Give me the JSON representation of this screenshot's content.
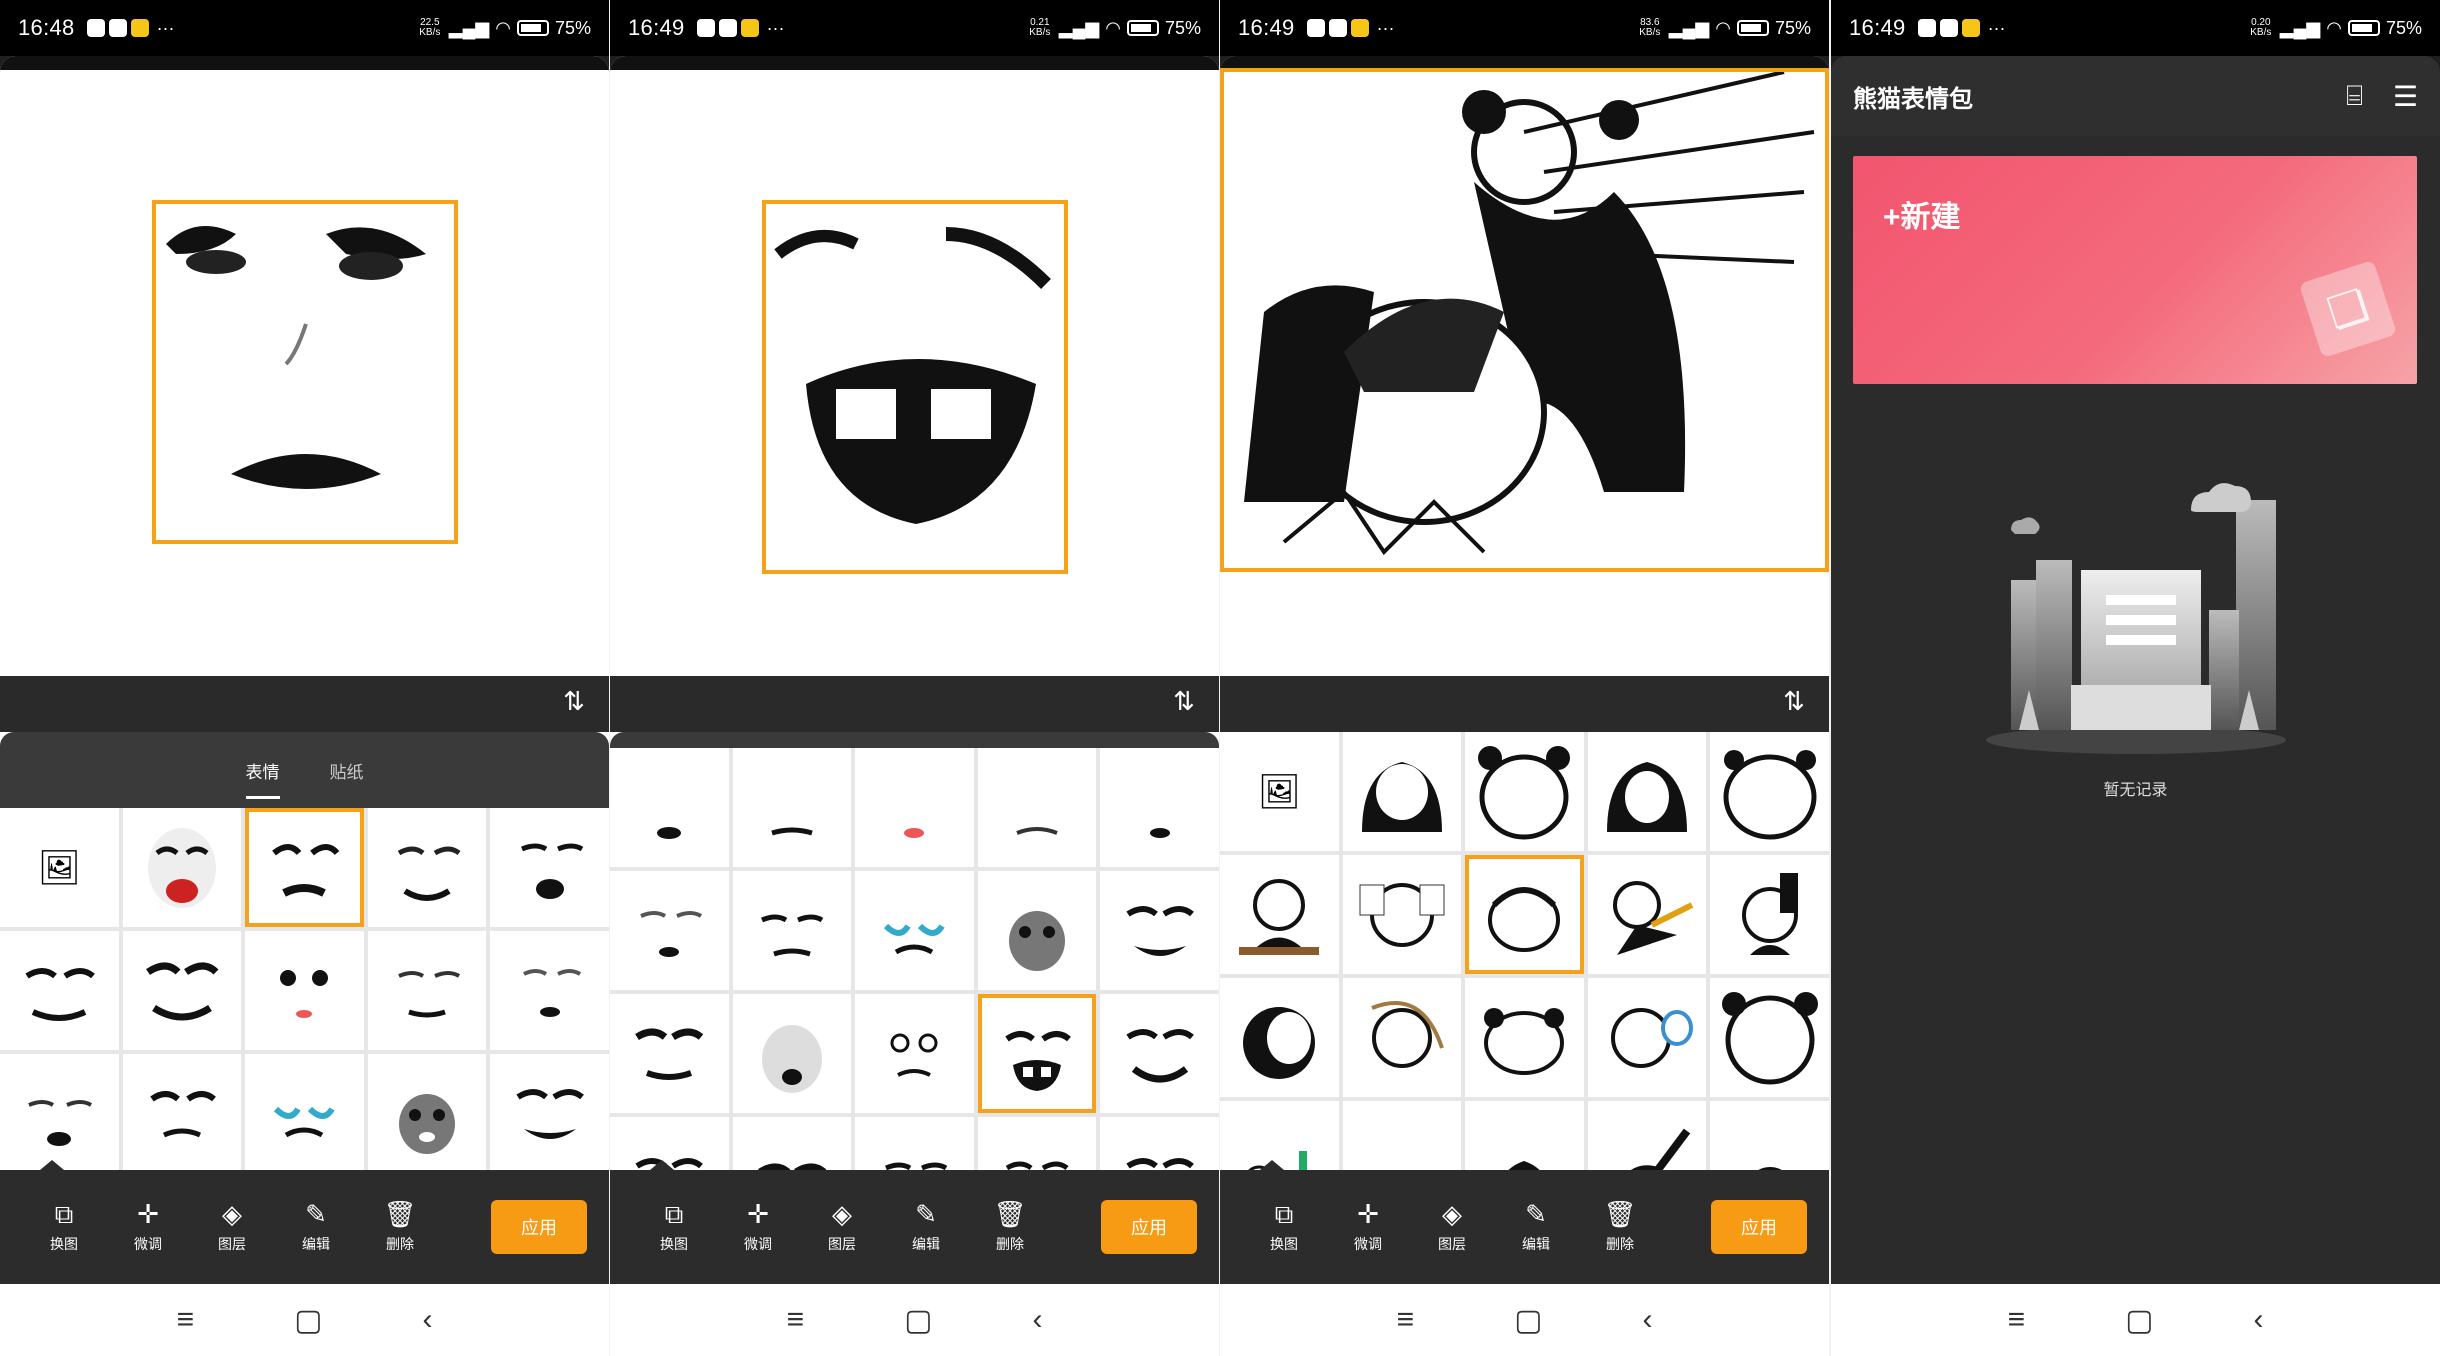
{
  "statusbars": [
    {
      "time": "16:48",
      "speed": "22.5\nKB/s",
      "battery": "75%"
    },
    {
      "time": "16:49",
      "speed": "0.21\nKB/s",
      "battery": "75%"
    },
    {
      "time": "16:49",
      "speed": "83.6\nKB/s",
      "battery": "75%"
    },
    {
      "time": "16:49",
      "speed": "0.20\nKB/s",
      "battery": "75%"
    }
  ],
  "editor": {
    "tabs": [
      "表情",
      "贴纸"
    ],
    "tools": [
      "换图",
      "微调",
      "图层",
      "编辑",
      "删除"
    ],
    "apply_label": "应用"
  },
  "home": {
    "title": "熊猫表情包",
    "new_label": "+新建",
    "empty_text": "暂无记录"
  },
  "colors": {
    "accent": "#f79a14",
    "selection": "#f5a11a",
    "card": "#f2556f"
  }
}
